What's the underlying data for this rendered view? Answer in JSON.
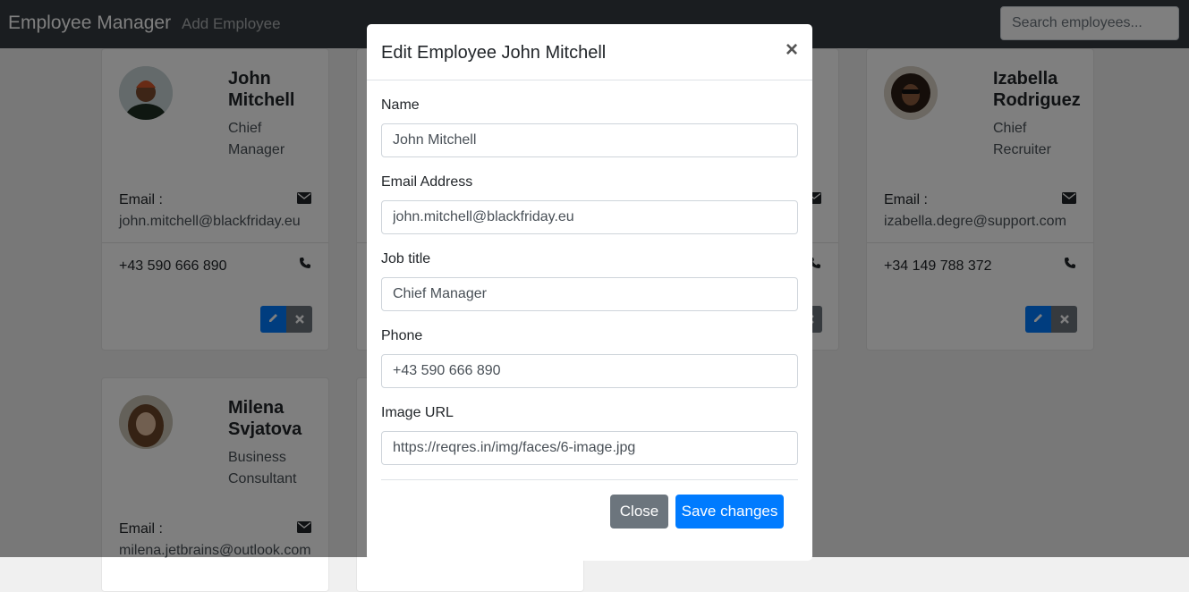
{
  "navbar": {
    "brand": "Employee Manager",
    "add_link": "Add Employee",
    "search_placeholder": "Search employees..."
  },
  "cards": [
    {
      "name": "John Mitchell",
      "job": "Chief Manager",
      "email_label": "Email :",
      "email": "john.mitchell@blackfriday.eu",
      "phone": "+43 590 666 890"
    },
    {
      "name": "Izabella Rodriguez",
      "job": "Chief Recruiter",
      "email_label": "Email :",
      "email": "izabella.degre@support.com",
      "phone": "+34 149 788 372"
    },
    {
      "name": "Milena Svjatova",
      "job": "Business Consultant",
      "email_label": "Email :",
      "email": "milena.jetbrains@outlook.com"
    }
  ],
  "modal": {
    "title": "Edit Employee John Mitchell",
    "close_x": "×",
    "fields": [
      {
        "label": "Name",
        "value": "John Mitchell"
      },
      {
        "label": "Email Address",
        "value": "john.mitchell@blackfriday.eu"
      },
      {
        "label": "Job title",
        "value": "Chief Manager"
      },
      {
        "label": "Phone",
        "value": "+43 590 666 890"
      },
      {
        "label": "Image URL",
        "value": "https://reqres.in/img/faces/6-image.jpg"
      }
    ],
    "close_button": "Close",
    "save_button": "Save changes"
  },
  "colors": {
    "navbar": "#343a40",
    "primary": "#007bff",
    "secondary": "#6c757d"
  },
  "icons": [
    "envelope-icon",
    "phone-icon",
    "pencil-icon",
    "times-icon",
    "close-icon"
  ]
}
